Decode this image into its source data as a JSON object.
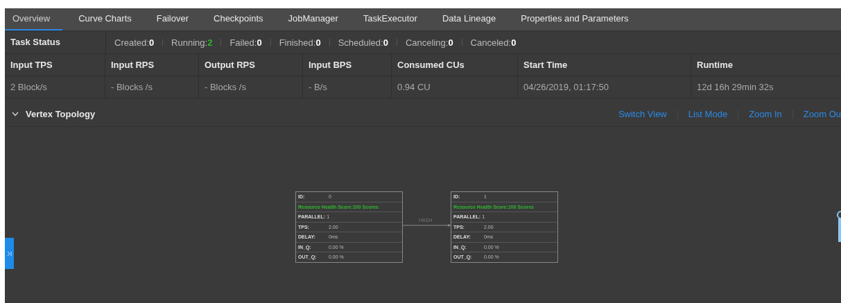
{
  "tabs": [
    {
      "label": "Overview",
      "selected": true
    },
    {
      "label": "Curve Charts",
      "selected": false
    },
    {
      "label": "Failover",
      "selected": false
    },
    {
      "label": "Checkpoints",
      "selected": false
    },
    {
      "label": "JobManager",
      "selected": false
    },
    {
      "label": "TaskExecutor",
      "selected": false
    },
    {
      "label": "Data Lineage",
      "selected": false
    },
    {
      "label": "Properties and Parameters",
      "selected": false
    }
  ],
  "task_status": {
    "label": "Task Status",
    "counts": [
      {
        "label": "Created:",
        "value": "0",
        "color": "#ffffff"
      },
      {
        "label": "Running:",
        "value": "2",
        "color": "#2fb52f"
      },
      {
        "label": "Failed:",
        "value": "0",
        "color": "#ffffff"
      },
      {
        "label": "Finished:",
        "value": "0",
        "color": "#ffffff"
      },
      {
        "label": "Scheduled:",
        "value": "0",
        "color": "#ffffff"
      },
      {
        "label": "Canceling:",
        "value": "0",
        "color": "#ffffff"
      },
      {
        "label": "Canceled:",
        "value": "0",
        "color": "#ffffff"
      }
    ]
  },
  "metrics": [
    {
      "header": "Input TPS",
      "value": "2 Block/s"
    },
    {
      "header": "Input RPS",
      "value": "- Blocks /s"
    },
    {
      "header": "Output RPS",
      "value": "- Blocks /s"
    },
    {
      "header": "Input BPS",
      "value": "- B/s"
    },
    {
      "header": "Consumed CUs",
      "value": "0.94 CU"
    },
    {
      "header": "Start Time",
      "value": "04/26/2019, 01:17:50"
    },
    {
      "header": "Runtime",
      "value": "12d 16h 29min 32s"
    }
  ],
  "topology": {
    "title": "Vertex Topology",
    "expanded": true,
    "actions": [
      "Switch View",
      "List Mode",
      "Zoom In",
      "Zoom Ou"
    ],
    "edge_label": "HASH",
    "nodes": [
      {
        "rows": [
          {
            "kind": "field",
            "label": "ID:",
            "value": "0"
          },
          {
            "kind": "health",
            "text": "Resource Health Score:100 Scores"
          },
          {
            "kind": "inline",
            "label": "PARALLEL:",
            "value": "1"
          },
          {
            "kind": "field",
            "label": "TPS:",
            "value": "2.00"
          },
          {
            "kind": "field",
            "label": "DELAY:",
            "value": "0ms"
          },
          {
            "kind": "field",
            "label": "IN_Q:",
            "value": "0.00 %"
          },
          {
            "kind": "field",
            "label": "OUT_Q:",
            "value": "0.00 %"
          }
        ]
      },
      {
        "rows": [
          {
            "kind": "field",
            "label": "ID:",
            "value": "1"
          },
          {
            "kind": "health",
            "text": "Resource Health Score:100 Scores"
          },
          {
            "kind": "inline",
            "label": "PARALLEL:",
            "value": "1"
          },
          {
            "kind": "field",
            "label": "TPS:",
            "value": "2.00"
          },
          {
            "kind": "field",
            "label": "DELAY:",
            "value": "0ms"
          },
          {
            "kind": "field",
            "label": "IN_Q:",
            "value": "0.00 %"
          },
          {
            "kind": "field",
            "label": "OUT_Q:",
            "value": "0.00 %"
          }
        ]
      }
    ]
  }
}
